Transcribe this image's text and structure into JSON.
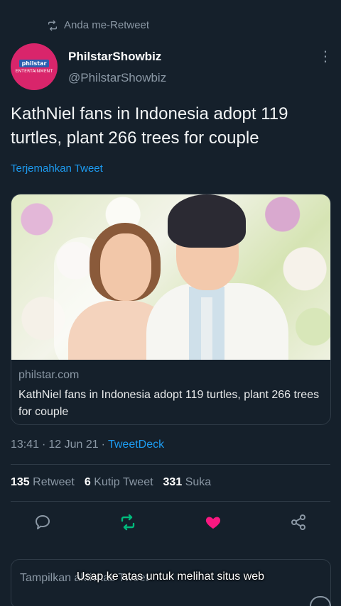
{
  "retweet_banner": {
    "text": "Anda me-Retweet",
    "icon": "retweet-icon"
  },
  "author": {
    "name": "PhilstarShowbiz",
    "handle": "@PhilstarShowbiz",
    "avatar_logo": "philstar",
    "avatar_sub": "ENTERTAINMENT",
    "avatar_color": "#d9256b"
  },
  "tweet": {
    "text": "KathNiel fans in Indonesia adopt 119 turtles, plant 266 trees for couple",
    "translate_label": "Terjemahkan Tweet"
  },
  "link_card": {
    "domain": "philstar.com",
    "title": "KathNiel fans in Indonesia adopt 119 turtles, plant 266 trees for couple"
  },
  "meta": {
    "time": "13:41",
    "date": "12 Jun 21",
    "separator": "·",
    "source": "TweetDeck"
  },
  "stats": {
    "retweets_count": "135",
    "retweets_label": "Retweet",
    "quotes_count": "6",
    "quotes_label": "Kutip Tweet",
    "likes_count": "331",
    "likes_label": "Suka"
  },
  "actions": [
    {
      "name": "reply",
      "icon": "reply-icon",
      "color": "#8b98a5"
    },
    {
      "name": "retweet",
      "icon": "retweet-icon",
      "color": "#00ba7c"
    },
    {
      "name": "like",
      "icon": "heart-icon",
      "color": "#f91880"
    },
    {
      "name": "share",
      "icon": "share-icon",
      "color": "#8b98a5"
    }
  ],
  "bottom_card": {
    "label": "Tampilkan aktivitas Tweet"
  },
  "overlay": {
    "swipe_text": "Usap ke atas untuk melihat situs web"
  },
  "colors": {
    "background": "#15202b",
    "accent": "#1d9bf0",
    "muted": "#8b98a5"
  }
}
